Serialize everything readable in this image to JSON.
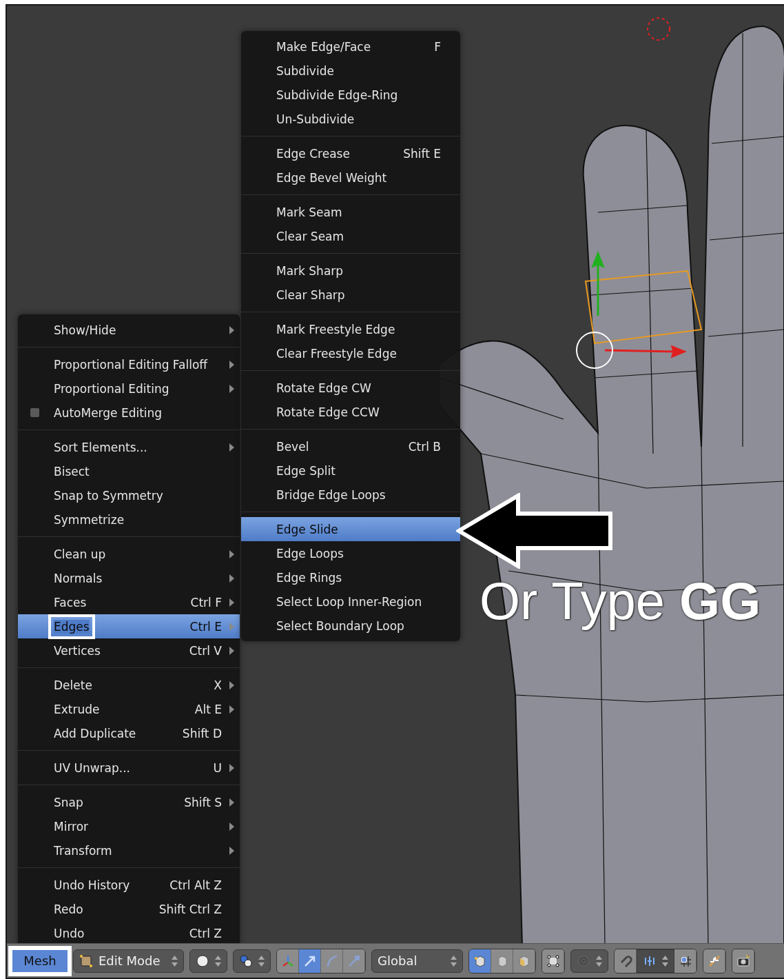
{
  "mesh_menu": {
    "groups": [
      [
        {
          "label": "Show/Hide",
          "submenu": true,
          "kind": "item",
          "selected": false,
          "outlined": false
        }
      ],
      [
        {
          "label": "Proportional Editing Falloff",
          "submenu": true,
          "kind": "item",
          "selected": false,
          "outlined": false
        },
        {
          "label": "Proportional Editing",
          "submenu": true,
          "kind": "item",
          "selected": false,
          "outlined": false
        },
        {
          "label": "AutoMerge Editing",
          "submenu": false,
          "kind": "checkbox",
          "checked": false,
          "selected": false,
          "outlined": false
        }
      ],
      [
        {
          "label": "Sort Elements...",
          "submenu": true,
          "kind": "item",
          "selected": false,
          "outlined": false
        },
        {
          "label": "Bisect",
          "submenu": false,
          "kind": "item",
          "selected": false,
          "outlined": false
        },
        {
          "label": "Snap to Symmetry",
          "submenu": false,
          "kind": "item",
          "selected": false,
          "outlined": false
        },
        {
          "label": "Symmetrize",
          "submenu": false,
          "kind": "item",
          "selected": false,
          "outlined": false
        }
      ],
      [
        {
          "label": "Clean up",
          "submenu": true,
          "kind": "item",
          "selected": false,
          "outlined": false
        },
        {
          "label": "Normals",
          "submenu": true,
          "kind": "item",
          "selected": false,
          "outlined": false
        },
        {
          "label": "Faces",
          "shortcut": "Ctrl F",
          "submenu": true,
          "kind": "item",
          "selected": false,
          "outlined": false
        },
        {
          "label": "Edges",
          "shortcut": "Ctrl E",
          "submenu": true,
          "kind": "item",
          "selected": true,
          "outlined": true
        },
        {
          "label": "Vertices",
          "shortcut": "Ctrl V",
          "submenu": true,
          "kind": "item",
          "selected": false,
          "outlined": false
        }
      ],
      [
        {
          "label": "Delete",
          "shortcut": "X",
          "submenu": true,
          "kind": "item",
          "selected": false,
          "outlined": false
        },
        {
          "label": "Extrude",
          "shortcut": "Alt E",
          "submenu": true,
          "kind": "item",
          "selected": false,
          "outlined": false
        },
        {
          "label": "Add Duplicate",
          "shortcut": "Shift D",
          "submenu": false,
          "kind": "item",
          "selected": false,
          "outlined": false
        }
      ],
      [
        {
          "label": "UV Unwrap...",
          "shortcut": "U",
          "submenu": true,
          "kind": "item",
          "selected": false,
          "outlined": false
        }
      ],
      [
        {
          "label": "Snap",
          "shortcut": "Shift S",
          "submenu": true,
          "kind": "item",
          "selected": false,
          "outlined": false
        },
        {
          "label": "Mirror",
          "submenu": true,
          "kind": "item",
          "selected": false,
          "outlined": false
        },
        {
          "label": "Transform",
          "submenu": true,
          "kind": "item",
          "selected": false,
          "outlined": false
        }
      ],
      [
        {
          "label": "Undo History",
          "shortcut": "Ctrl Alt Z",
          "submenu": false,
          "kind": "item",
          "selected": false,
          "outlined": false
        },
        {
          "label": "Redo",
          "shortcut": "Shift Ctrl Z",
          "submenu": false,
          "kind": "item",
          "selected": false,
          "outlined": false
        },
        {
          "label": "Undo",
          "shortcut": "Ctrl Z",
          "submenu": false,
          "kind": "item",
          "selected": false,
          "outlined": false
        }
      ]
    ]
  },
  "edges_menu": {
    "groups": [
      [
        {
          "label": "Make Edge/Face",
          "shortcut": "F",
          "selected": false
        },
        {
          "label": "Subdivide",
          "selected": false
        },
        {
          "label": "Subdivide Edge-Ring",
          "selected": false
        },
        {
          "label": "Un-Subdivide",
          "selected": false
        }
      ],
      [
        {
          "label": "Edge Crease",
          "shortcut": "Shift E",
          "selected": false
        },
        {
          "label": "Edge Bevel Weight",
          "selected": false
        }
      ],
      [
        {
          "label": "Mark Seam",
          "selected": false
        },
        {
          "label": "Clear Seam",
          "selected": false
        }
      ],
      [
        {
          "label": "Mark Sharp",
          "selected": false
        },
        {
          "label": "Clear Sharp",
          "selected": false
        }
      ],
      [
        {
          "label": "Mark Freestyle Edge",
          "selected": false
        },
        {
          "label": "Clear Freestyle Edge",
          "selected": false
        }
      ],
      [
        {
          "label": "Rotate Edge CW",
          "selected": false
        },
        {
          "label": "Rotate Edge CCW",
          "selected": false
        }
      ],
      [
        {
          "label": "Bevel",
          "shortcut": "Ctrl B",
          "selected": false
        },
        {
          "label": "Edge Split",
          "selected": false
        },
        {
          "label": "Bridge Edge Loops",
          "selected": false
        }
      ],
      [
        {
          "label": "Edge Slide",
          "selected": true
        },
        {
          "label": "Edge Loops",
          "selected": false
        },
        {
          "label": "Edge Rings",
          "selected": false
        },
        {
          "label": "Select Loop Inner-Region",
          "selected": false
        },
        {
          "label": "Select Boundary Loop",
          "selected": false
        }
      ]
    ]
  },
  "annotation": {
    "text": "Or Type **GG**"
  },
  "header": [
    {
      "kind": "menu",
      "label": "Mesh",
      "selected": true,
      "outlined": true
    },
    {
      "kind": "dropdown",
      "label": "Edit Mode"
    },
    {
      "kind": "dropdown"
    },
    {
      "kind": "dropdown"
    },
    {
      "kind": "group",
      "buttons": [
        {
          "selected": false
        },
        {
          "selected": true
        },
        {
          "selected": false
        },
        {
          "selected": false
        }
      ]
    },
    {
      "kind": "dropdown",
      "label": "Global"
    },
    {
      "kind": "group",
      "buttons": [
        {
          "selected": true
        },
        {
          "selected": false
        },
        {
          "selected": false
        }
      ]
    },
    {
      "kind": "group",
      "buttons": [
        {
          "selected": false
        }
      ]
    },
    {
      "kind": "dropdown"
    },
    {
      "kind": "snap",
      "buttons": [
        {
          "selected": false
        }
      ],
      "after": [
        {
          "selected": false
        }
      ]
    },
    {
      "kind": "group",
      "buttons": [
        {
          "selected": false
        }
      ]
    },
    {
      "kind": "group",
      "buttons": [
        {
          "selected": false
        }
      ]
    }
  ]
}
